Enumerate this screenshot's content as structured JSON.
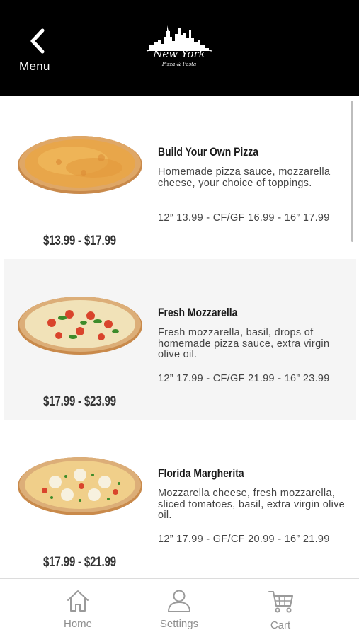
{
  "header": {
    "back_label": "Menu",
    "logo_title": "New York",
    "logo_subtitle": "Pizza & Pasta",
    "background": "#000000"
  },
  "items": [
    {
      "name": "Build Your Own Pizza",
      "description": "Homemade pizza sauce, mozzarella cheese, your choice of toppings.",
      "sizes": "12” 13.99 - CF/GF 16.99 - 16” 17.99",
      "price": "$13.99 - $17.99",
      "image": "cheese-pizza"
    },
    {
      "name": "Fresh Mozzarella",
      "description": "Fresh mozzarella, basil, drops of homemade pizza sauce, extra virgin olive oil.",
      "sizes": "12” 17.99 - CF/GF 21.99 - 16” 23.99",
      "price": "$17.99 - $23.99",
      "image": "fresh-mozzarella-pizza"
    },
    {
      "name": "Florida Margherita",
      "description": "Mozzarella cheese, fresh mozzarella, sliced tomatoes, basil, extra virgin olive oil.",
      "sizes": "12” 17.99 - GF/CF 20.99 - 16” 21.99",
      "price": "$17.99 - $21.99",
      "image": "margherita-pizza"
    }
  ],
  "tabbar": {
    "tabs": [
      {
        "label": "Home",
        "icon": "home-icon"
      },
      {
        "label": "Settings",
        "icon": "user-icon"
      },
      {
        "label": "Cart",
        "icon": "cart-icon"
      }
    ],
    "inactive_color": "#8e8e8e"
  }
}
